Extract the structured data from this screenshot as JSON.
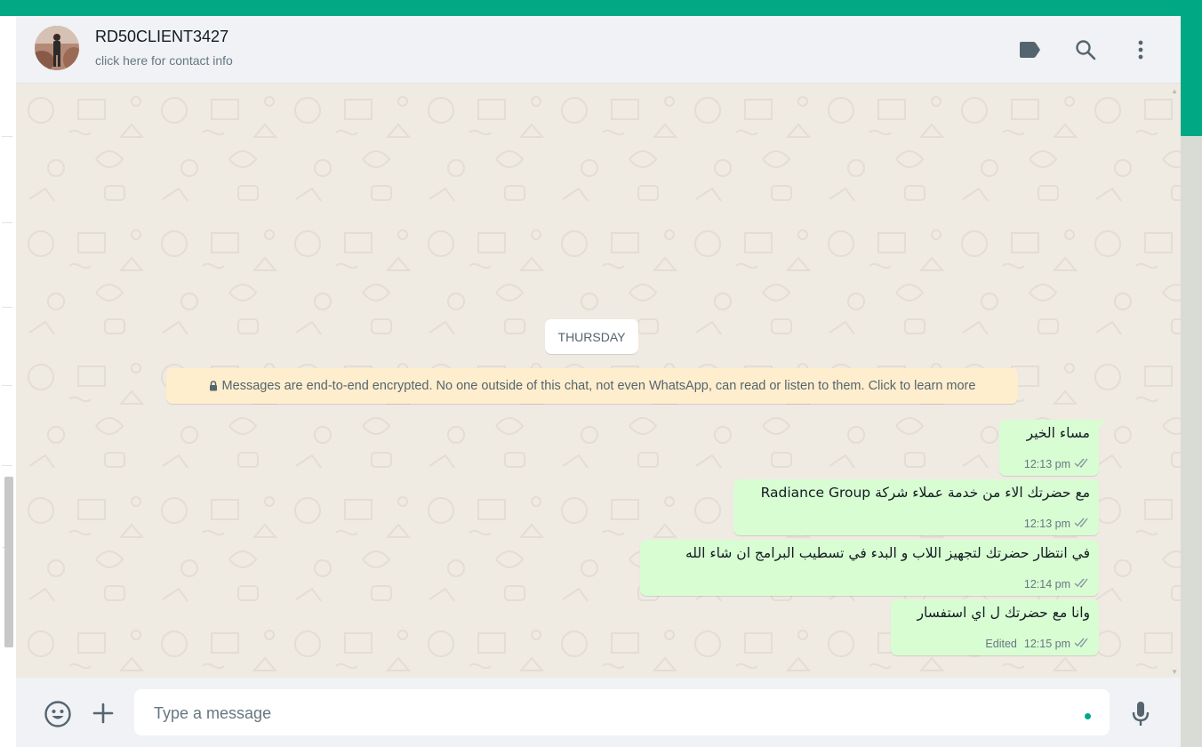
{
  "header": {
    "contact_name": "RD50CLIENT3427",
    "contact_subtitle": "click here for contact info",
    "icons": [
      "label-icon",
      "search-icon",
      "menu-icon"
    ]
  },
  "chat": {
    "day_chip": "THURSDAY",
    "encryption_notice": "Messages are end-to-end encrypted. No one outside of this chat, not even WhatsApp, can read or listen to them. Click to learn more",
    "messages": [
      {
        "text": "مساء الخير",
        "time": "12:13 pm",
        "status": "read",
        "edited": ""
      },
      {
        "text": "مع حضرتك الاء من خدمة عملاء شركة Radiance Group",
        "time": "12:13 pm",
        "status": "read",
        "edited": ""
      },
      {
        "text": "في انتظار حضرتك لتجهيز اللاب و البدء في تسطيب البرامج ان شاء الله",
        "time": "12:14 pm",
        "status": "read",
        "edited": ""
      },
      {
        "text": "وانا مع حضرتك ل اي استفسار",
        "time": "12:15 pm",
        "status": "read",
        "edited": "Edited"
      }
    ]
  },
  "composer": {
    "placeholder": "Type a message",
    "icons": [
      "emoji-icon",
      "attach-plus-icon",
      "microphone-icon"
    ]
  },
  "colors": {
    "brand_band": "#00a884",
    "outgoing_bubble": "#d9fdd3",
    "chat_background": "#efeae2",
    "notice_background": "#ffeecd"
  }
}
